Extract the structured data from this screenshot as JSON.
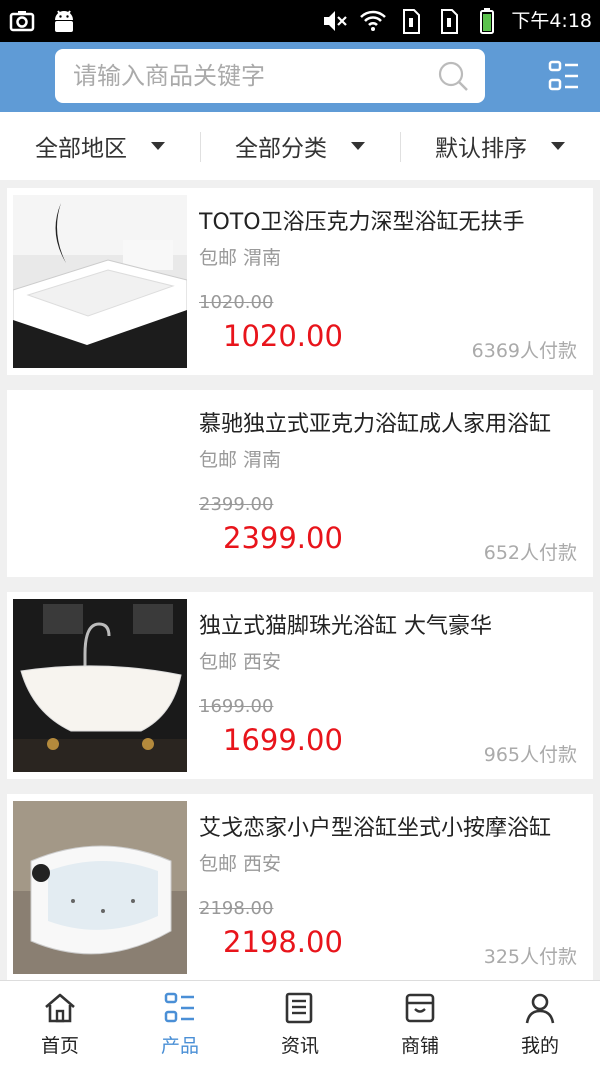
{
  "status_bar": {
    "time": "下午4:18"
  },
  "search": {
    "placeholder": "请输入商品关键字"
  },
  "filters": [
    {
      "label": "全部地区"
    },
    {
      "label": "全部分类"
    },
    {
      "label": "默认排序"
    }
  ],
  "products": [
    {
      "title": "TOTO卫浴压克力深型浴缸无扶手",
      "location": "包邮 渭南",
      "original_price": "1020.00",
      "price": "1020.00",
      "sold": "6369人付款"
    },
    {
      "title": "慕驰独立式亚克力浴缸成人家用浴缸",
      "location": "包邮 渭南",
      "original_price": "2399.00",
      "price": "2399.00",
      "sold": "652人付款"
    },
    {
      "title": "独立式猫脚珠光浴缸 大气豪华",
      "location": "包邮 西安",
      "original_price": "1699.00",
      "price": "1699.00",
      "sold": "965人付款"
    },
    {
      "title": "艾戈恋家小户型浴缸坐式小按摩浴缸",
      "location": "包邮 西安",
      "original_price": "2198.00",
      "price": "2198.00",
      "sold": "325人付款"
    }
  ],
  "bottom_nav": [
    {
      "label": "首页",
      "icon": "home-icon"
    },
    {
      "label": "产品",
      "icon": "products-icon",
      "active": true
    },
    {
      "label": "资讯",
      "icon": "news-icon"
    },
    {
      "label": "商铺",
      "icon": "shop-icon"
    },
    {
      "label": "我的",
      "icon": "user-icon"
    }
  ],
  "colors": {
    "header": "#5f9bd6",
    "price": "#e8141b",
    "active_nav": "#4a8fd6"
  }
}
